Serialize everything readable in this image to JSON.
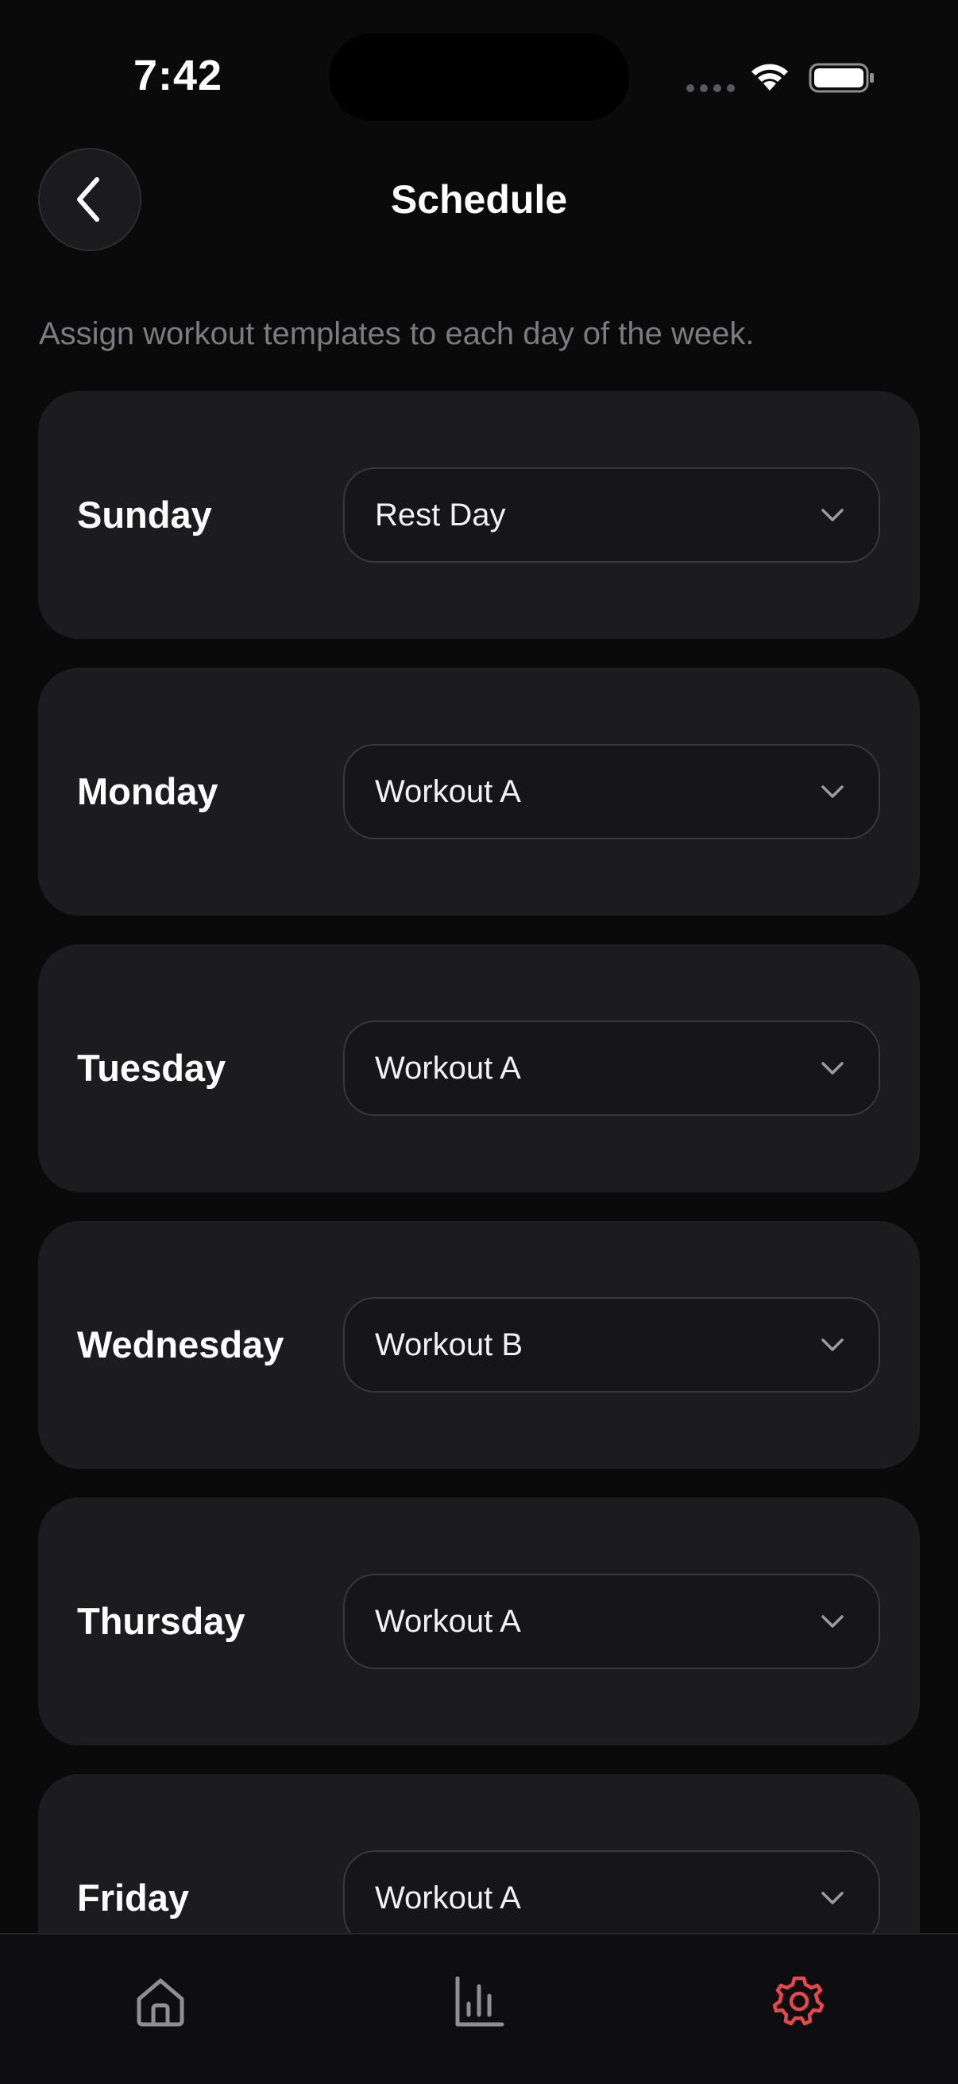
{
  "status_bar": {
    "time": "7:42"
  },
  "header": {
    "title": "Schedule",
    "back_icon": "chevron-left-icon"
  },
  "subtitle": "Assign workout templates to each day of the week.",
  "days": [
    {
      "day": "Sunday",
      "template": "Rest Day"
    },
    {
      "day": "Monday",
      "template": "Workout A"
    },
    {
      "day": "Tuesday",
      "template": "Workout A"
    },
    {
      "day": "Wednesday",
      "template": "Workout B"
    },
    {
      "day": "Thursday",
      "template": "Workout A"
    },
    {
      "day": "Friday",
      "template": "Workout A"
    }
  ],
  "tab_bar": {
    "tabs": [
      {
        "icon": "home-icon",
        "active": false
      },
      {
        "icon": "bar-chart-icon",
        "active": false
      },
      {
        "icon": "gear-icon",
        "active": true
      }
    ]
  },
  "colors": {
    "background": "#0a0a0b",
    "card": "#1c1c1f",
    "accent_active_tab": "#e5484d",
    "inactive_icon": "#8e8e93",
    "subtitle_text": "#7b7b80"
  }
}
